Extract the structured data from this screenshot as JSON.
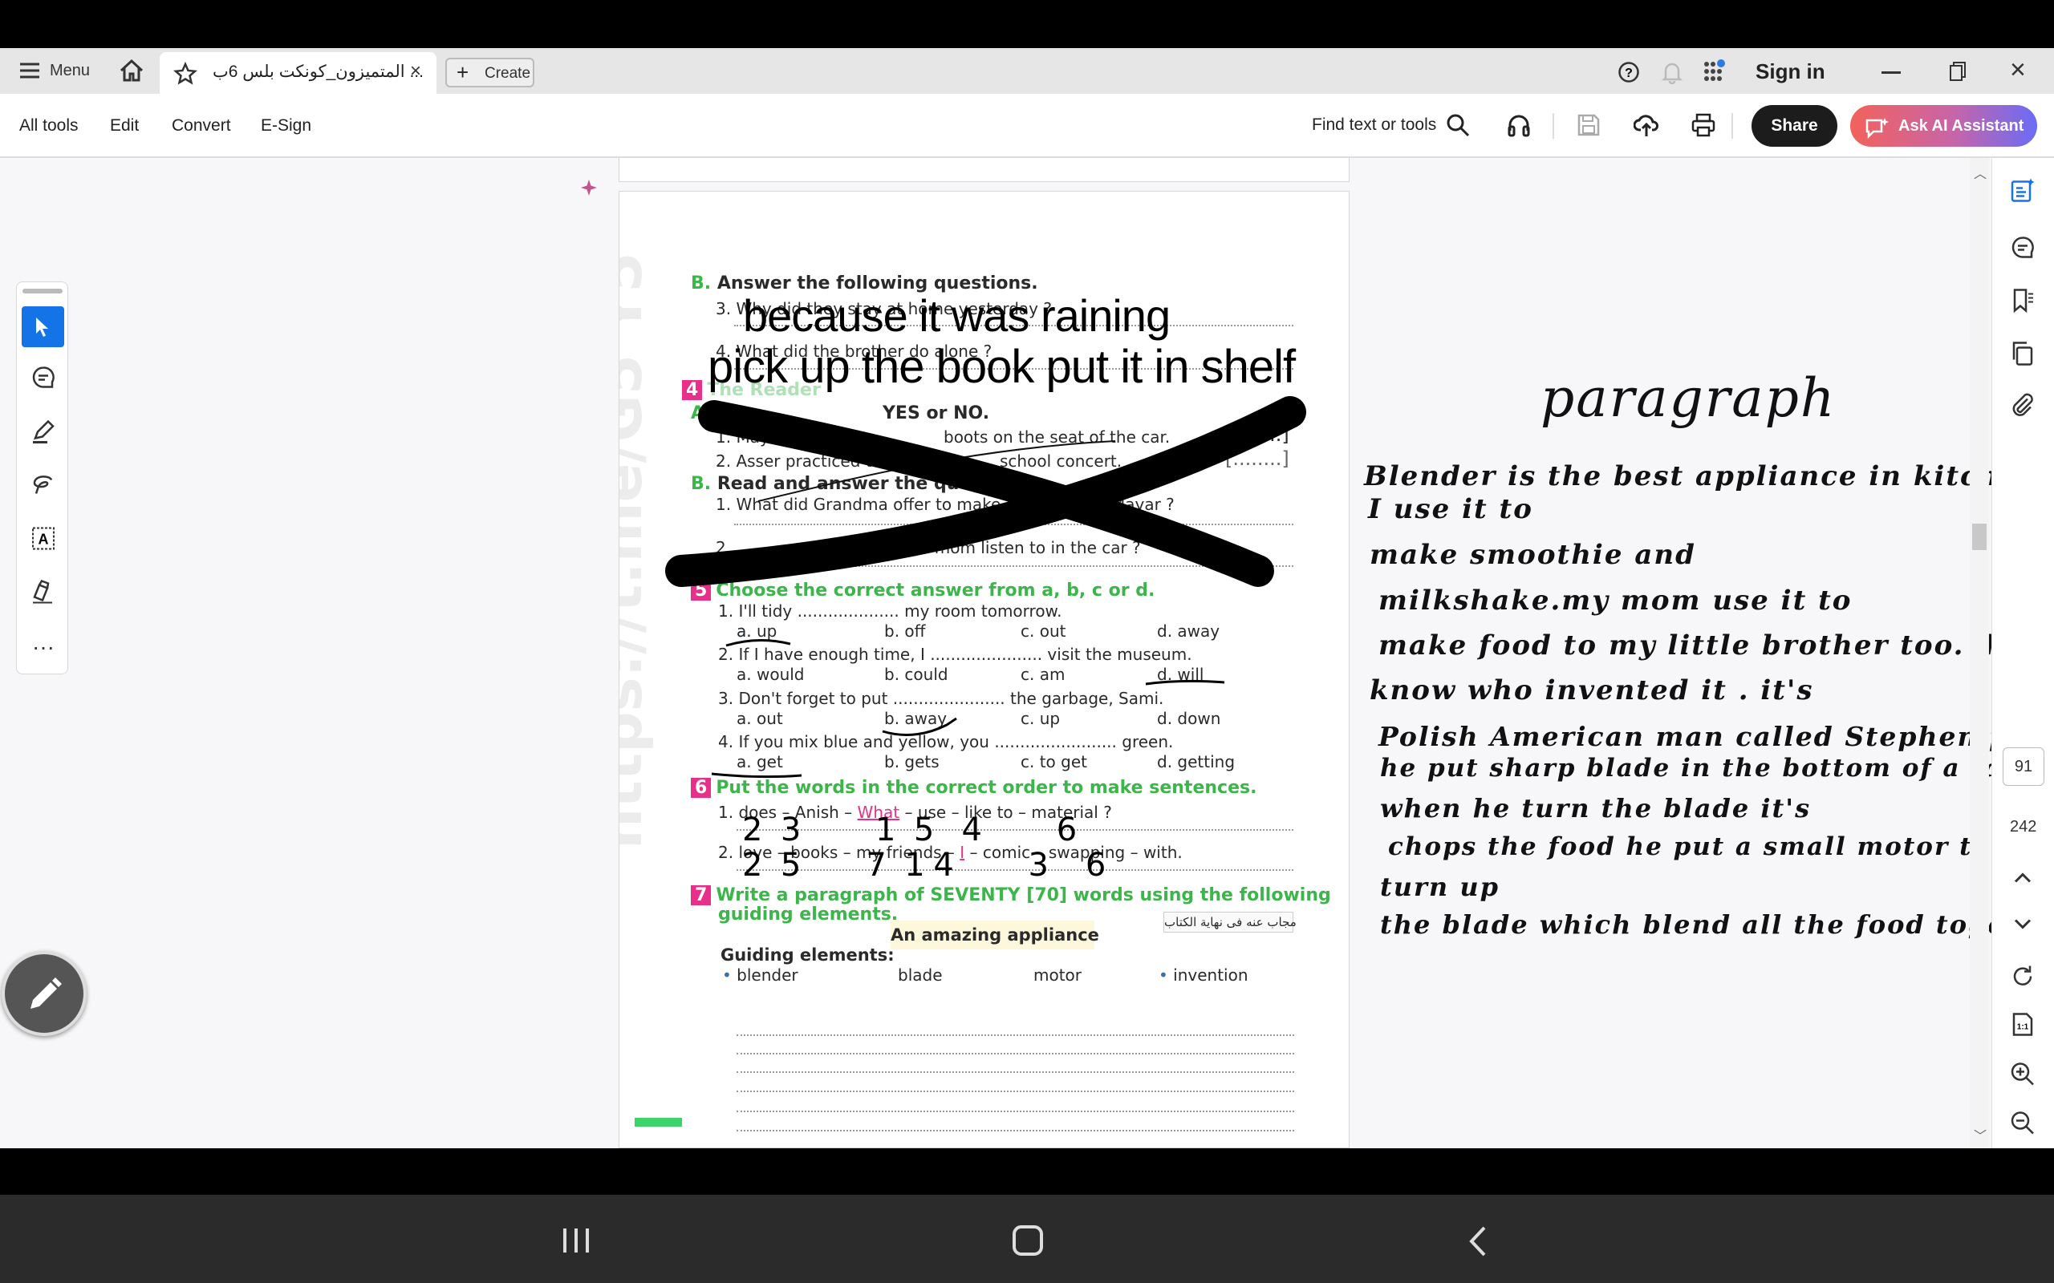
{
  "tabbar": {
    "menu_label": "Menu",
    "tab_title": "المتميزون_كونكت بلس 6ب ...",
    "create_label": "Create",
    "sign_in": "Sign in"
  },
  "toolbar": {
    "items": [
      "All tools",
      "Edit",
      "Convert",
      "E-Sign"
    ],
    "find_label": "Find text or tools",
    "share": "Share",
    "ask_ai": "Ask AI Assistant"
  },
  "document": {
    "watermark": "https://t.me/G5 Y5",
    "secB_title": "Answer the following questions.",
    "secB_letter": "B.",
    "q3": "3. Why did they stay at home yesterday ?",
    "q4": "4. What did the brother do alone ?",
    "ans3": "because it was raining",
    "ans4": "pick up the book put it in shelf",
    "s4_num": "4",
    "s4_title": "The Reader",
    "s4a_letter": "A",
    "s4a_tail": "YES or NO.",
    "s4a_1a": "1. Mayar found so",
    "s4a_1b": "boots on the seat of the car.",
    "s4a_2a": "2. Asser practiced the piano",
    "s4a_2b": "school concert.",
    "s4b_letter": "B.",
    "s4b_title": "Read and answer the questions.",
    "s4b_1a": "1.  What did Grandma offer to make",
    "s4b_1b": "Mayar ?",
    "s4b_2a": "2.",
    "s4b_2b": "ugar and her mom listen to in the car ?",
    "s5_num": "5",
    "s5_title": "Choose the correct answer from a, b, c or d.",
    "s5_questions": [
      {
        "q": "1. I'll tidy .................... my room tomorrow.",
        "opts": [
          "a. up",
          "b. off",
          "c. out",
          "d. away"
        ]
      },
      {
        "q": "2. If I have enough time, I ...................... visit the museum.",
        "opts": [
          "a. would",
          "b. could",
          "c. am",
          "d. will"
        ]
      },
      {
        "q": "3. Don't forget to put ...................... the garbage, Sami.",
        "opts": [
          "a. out",
          "b. away",
          "c. up",
          "d. down"
        ]
      },
      {
        "q": "4. If you mix blue and yellow, you ........................ green.",
        "opts": [
          "a. get",
          "b. gets",
          "c. to get",
          "d. getting"
        ]
      }
    ],
    "s6_num": "6",
    "s6_title": "Put the words in the correct order to make sentences.",
    "s6_1a": "1. does – Anish – ",
    "s6_1b": "What",
    "s6_1c": " – use – like to – material ?",
    "s6_2a": "2. love – books – my friends – ",
    "s6_2b": "I",
    "s6_2c": " – comic – swapping – with.",
    "s6_1_hand": "2  3        1  5   4        6",
    "s6_2_hand": "2  5       7  1 4        3    6",
    "s7_num": "7",
    "s7_line1": "Write a paragraph of SEVENTY [70] words using the following",
    "s7_line2": "guiding elements.",
    "answer_note": "مجاب عنه فى نهاية الكتاب",
    "topic": "An amazing appliance",
    "guiding_label": "Guiding elements:",
    "guiding": [
      "blender",
      "blade",
      "motor",
      "invention"
    ]
  },
  "annotation": {
    "title": "paragraph",
    "lines": [
      "Blender is the best appliance in kitchen",
      "I use it to",
      "make smoothie and",
      "milkshake.my mom use it to",
      "make food to my little brother too. did you",
      "know who invented it . it's",
      "Polish American man called Stephen poplawski",
      "he put sharp blade in the bottom of a tall glass",
      "when he turn the blade it's",
      "chops the food he put a small motor the motor",
      "turn up",
      "the blade which blend all the food together."
    ]
  },
  "pager": {
    "current": "91",
    "total": "242"
  },
  "colors": {
    "accent": "#1473e6",
    "green": "#3cb54a",
    "pink": "#e8308a"
  }
}
